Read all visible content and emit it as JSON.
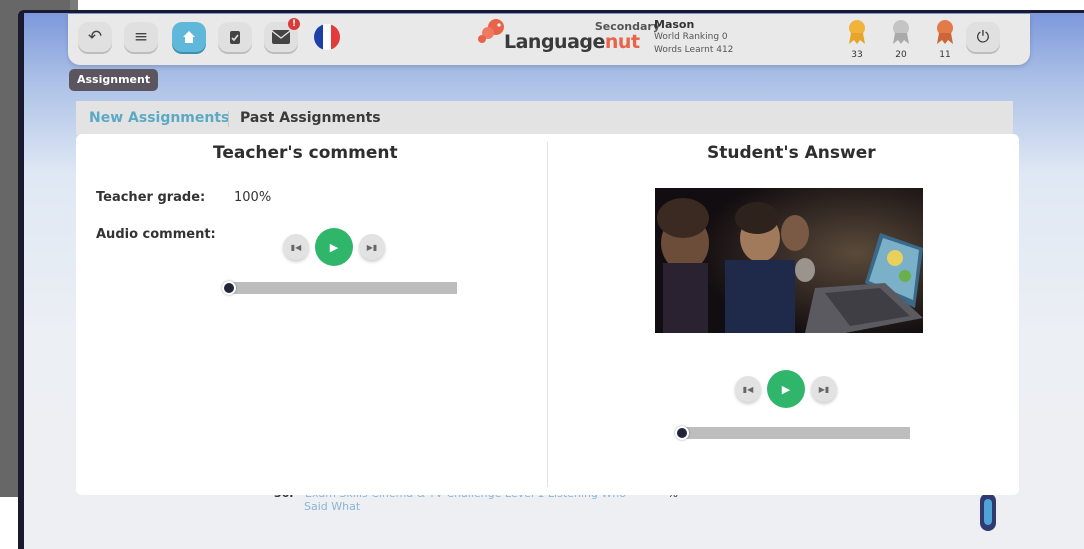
{
  "app": {
    "name": "Languagenut",
    "edition": "Secondary"
  },
  "toolbar": {
    "back_icon": "back-arrow-icon",
    "menu_icon": "menu-icon",
    "home_icon": "home-icon",
    "tasks_icon": "clipboard-check-icon",
    "mail_icon": "envelope-icon",
    "mail_badge": "!",
    "language_flag": "france-flag"
  },
  "logo": {
    "prefix": "Language",
    "suffix": "nut"
  },
  "user": {
    "name": "Mason",
    "world_ranking": "World Ranking 0",
    "words_learnt": "Words Learnt 412"
  },
  "medals": [
    {
      "name": "gold",
      "count": "33",
      "color": "#f0b33b"
    },
    {
      "name": "silver",
      "count": "20",
      "color": "#b8b8b8"
    },
    {
      "name": "bronze",
      "count": "11",
      "color": "#e27a4a"
    }
  ],
  "section_label": "Assignment",
  "tabs": {
    "new": "New Assignments",
    "past": "Past Assignments"
  },
  "background_row": {
    "number": "36.",
    "items": "Exam Skills    Cinema & TV    Challenge Level 1    Listening    Who",
    "continued": "Said What",
    "pct": "%"
  },
  "teacher": {
    "heading": "Teacher's comment",
    "grade_label": "Teacher grade:",
    "grade_value": "100%",
    "audio_label": "Audio comment:",
    "audio_progress": 0
  },
  "student": {
    "heading": "Student's Answer",
    "media": "photo of children watching a laptop in a dark room",
    "audio_progress": 0
  },
  "colors": {
    "accent_teal": "#5ba9c5",
    "play_green": "#2fb66a",
    "logo_orange": "#e8634a",
    "label_bg": "#5b5560"
  }
}
